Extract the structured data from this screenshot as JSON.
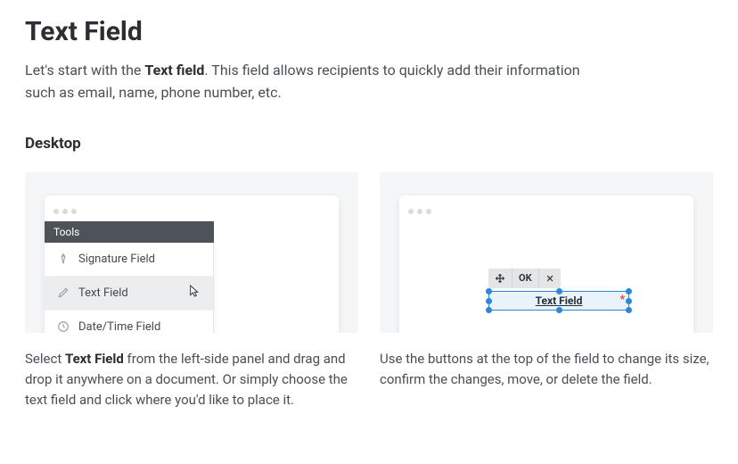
{
  "heading": "Text Field",
  "intro_before": "Let's start with the ",
  "intro_strong": "Text field",
  "intro_after": ". This field allows recipients to quickly add their information such as email, name, phone number, etc.",
  "subheading": "Desktop",
  "left": {
    "tools_label": "Tools",
    "items": [
      {
        "label": "Signature Field"
      },
      {
        "label": "Text Field"
      },
      {
        "label": "Date/Time Field"
      }
    ],
    "caption_before": "Select ",
    "caption_strong": "Text Field",
    "caption_after": " from the left-side panel and drag and drop it anywhere on a document. Or simply choose the text field and click where you'd like to place it."
  },
  "right": {
    "toolbar": {
      "ok": "OK"
    },
    "field_label": "Text Field",
    "asterisk": "*",
    "caption": "Use the buttons at the top of the field to change its size, confirm the changes, move, or delete the field."
  }
}
